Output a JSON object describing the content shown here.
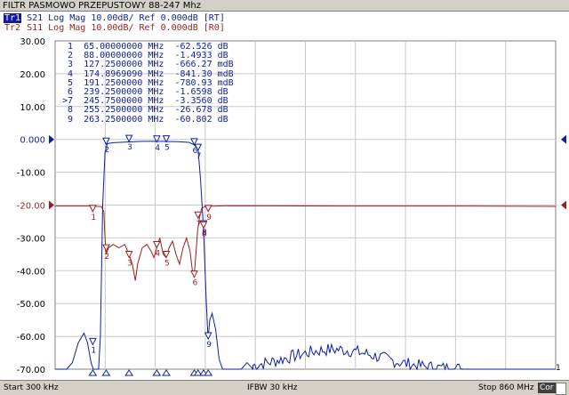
{
  "window": {
    "title": "FILTR PASMOWO PRZEPUSTOWY 88-247 Mhz"
  },
  "traces": [
    {
      "tag": "Tr1",
      "text": " S21 Log Mag 10.00dB/ Ref 0.000dB [RT]",
      "color": "#0e1ea0"
    },
    {
      "tag": "Tr2",
      "text": " S11 Log Mag 10.00dB/ Ref 0.000dB [R0]",
      "color": "#9b1e1e"
    }
  ],
  "axis": {
    "y_labels": [
      "30.00",
      "20.00",
      "10.00",
      "0.000",
      "-10.00",
      "-20.00",
      "-30.00",
      "-40.00",
      "-50.00",
      "-60.00",
      "-70.00"
    ],
    "ref_marker_label": "1"
  },
  "markers": [
    {
      "id": "1",
      "freq": "65.00000000 MHz",
      "value": "-62.526",
      "unit": "dB"
    },
    {
      "id": "2",
      "freq": "88.00000000 MHz",
      "value": "-1.4933",
      "unit": "dB"
    },
    {
      "id": "3",
      "freq": "127.2500000 MHz",
      "value": "-666.27",
      "unit": "mdB"
    },
    {
      "id": "4",
      "freq": "174.8969090 MHz",
      "value": "-841.30",
      "unit": "mdB"
    },
    {
      "id": "5",
      "freq": "191.2500000 MHz",
      "value": "-780.93",
      "unit": "mdB"
    },
    {
      "id": "6",
      "freq": "239.2500000 MHz",
      "value": "-1.6598",
      "unit": "dB"
    },
    {
      "id": ">7",
      "freq": "245.7500000 MHz",
      "value": "-3.3560",
      "unit": "dB"
    },
    {
      "id": "8",
      "freq": "255.2500000 MHz",
      "value": "-26.678",
      "unit": "dB"
    },
    {
      "id": "9",
      "freq": "263.2500000 MHz",
      "value": "-60.802",
      "unit": "dB"
    }
  ],
  "status": {
    "start": "Start 300 kHz",
    "ifbw": "IFBW 30 kHz",
    "stop": "Stop 860 MHz",
    "cor": "Cor"
  },
  "colors": {
    "s21": "#0e1ea0",
    "s11": "#9b1e1e",
    "grid": "#c8c8c8"
  }
}
